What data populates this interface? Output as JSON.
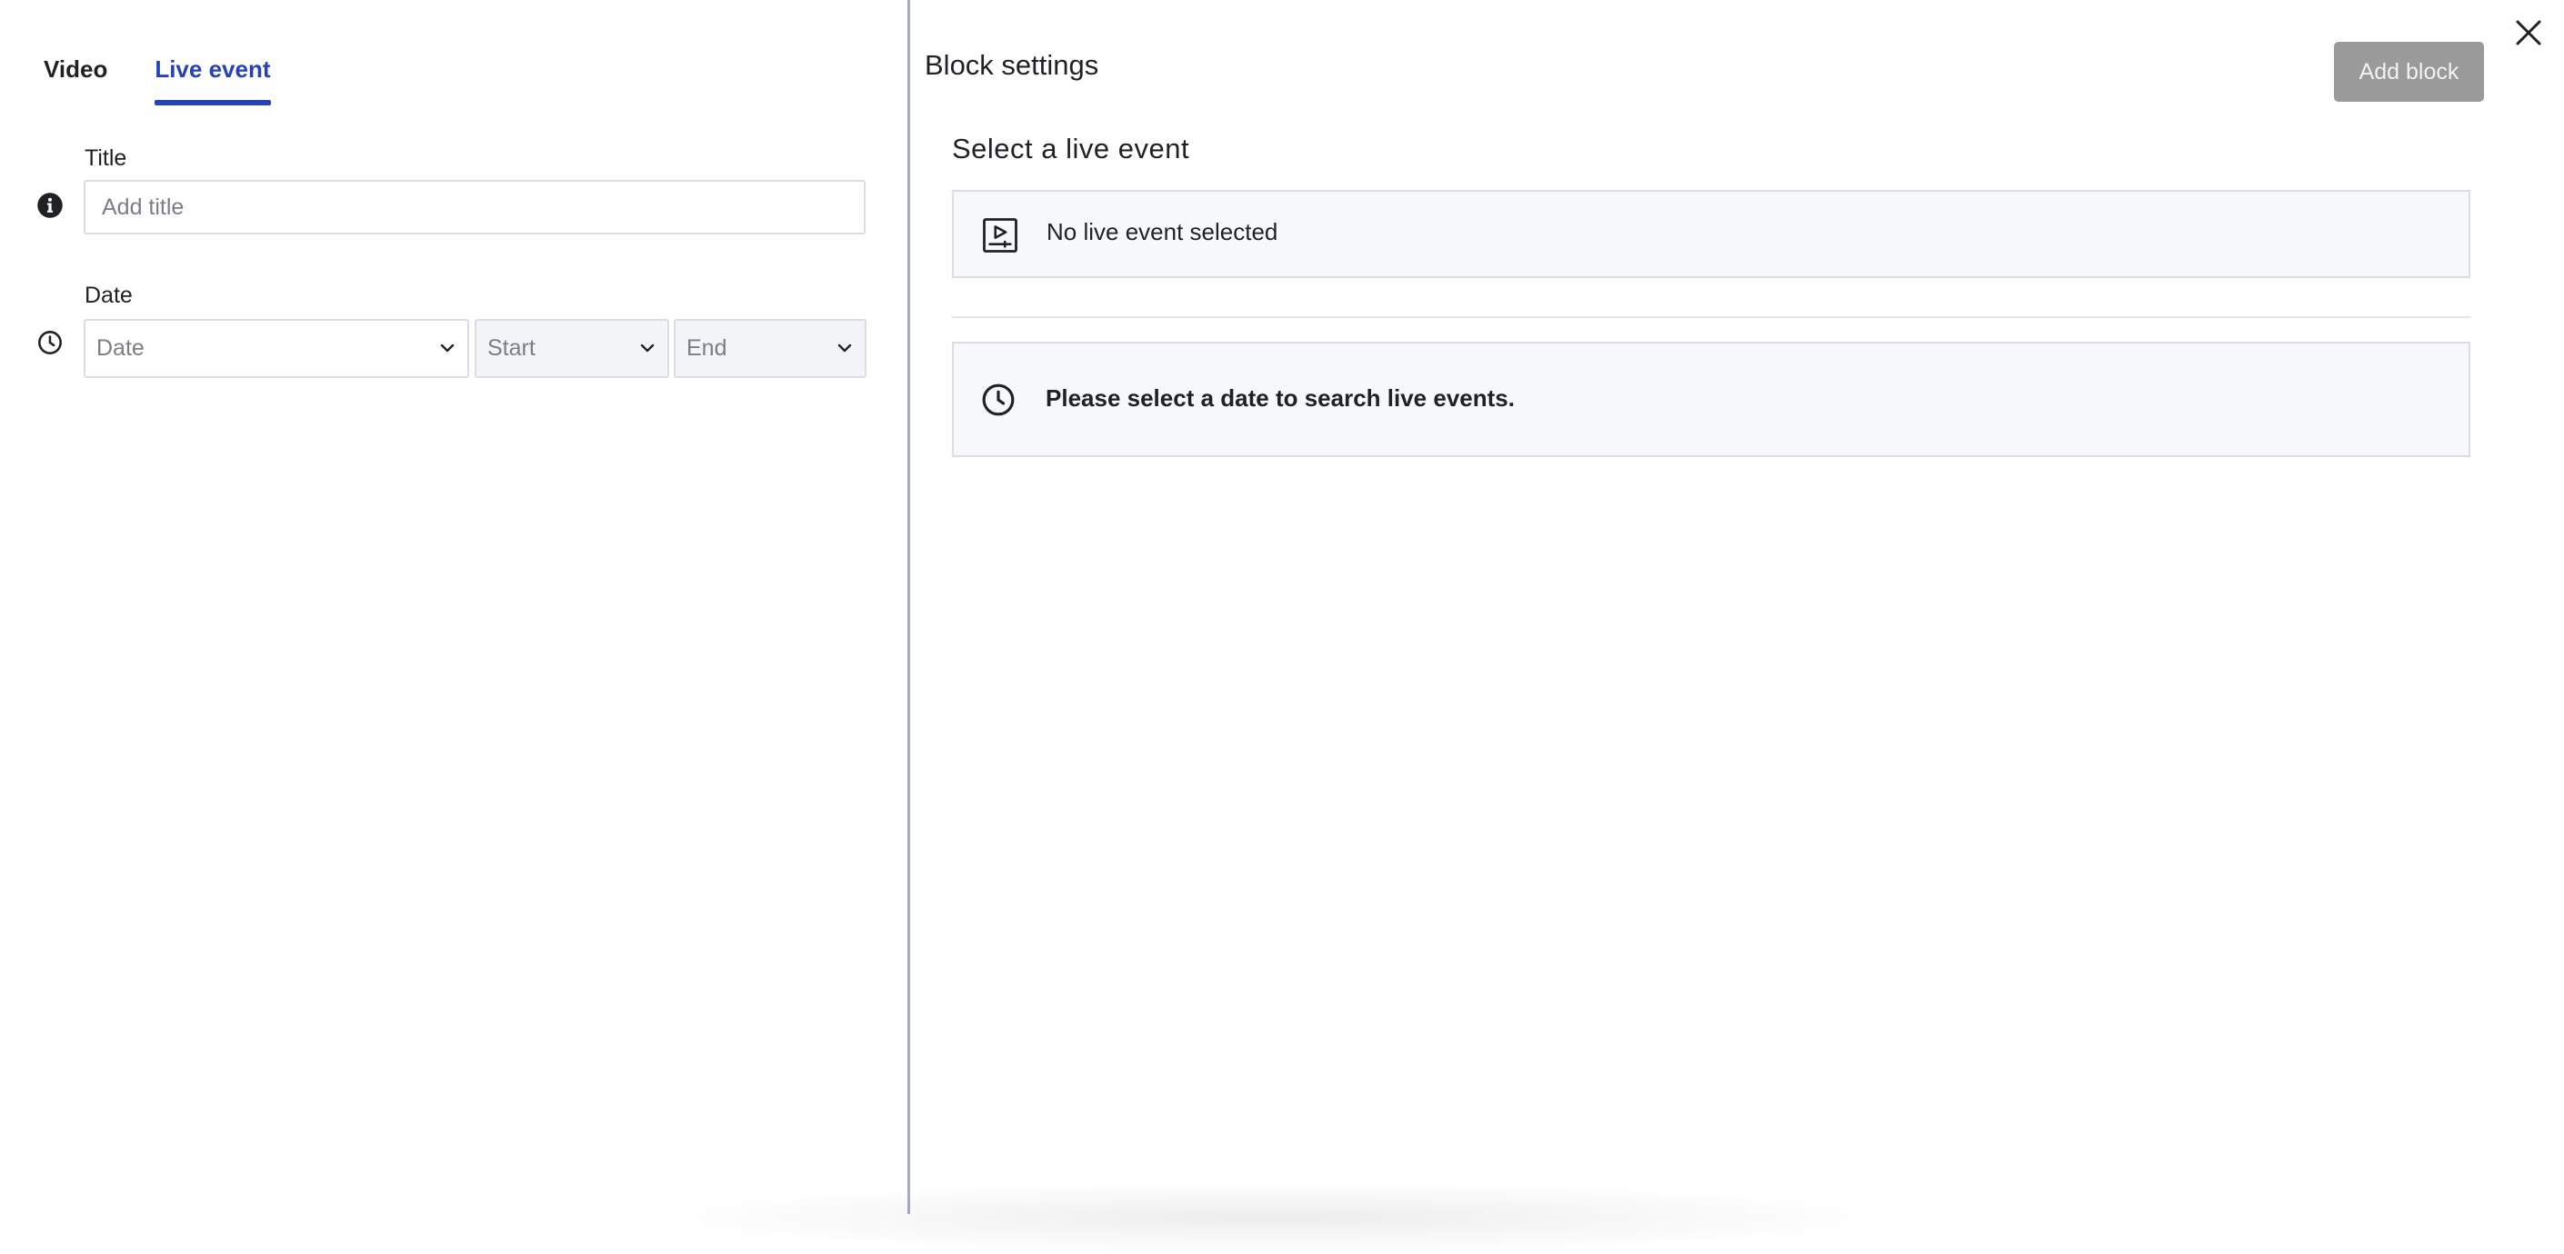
{
  "tabs": [
    {
      "label": "Video",
      "active": false
    },
    {
      "label": "Live event",
      "active": true
    }
  ],
  "form": {
    "title_label": "Title",
    "title_placeholder": "Add title",
    "title_value": "",
    "date_label": "Date",
    "date_select": {
      "value": "Date"
    },
    "start_select": {
      "value": "Start"
    },
    "end_select": {
      "value": "End"
    }
  },
  "panel": {
    "title": "Block settings",
    "add_block_label": "Add block",
    "section_heading": "Select a live event",
    "no_event_text": "No live event selected",
    "date_notice": "Please select a date to search live events."
  },
  "icons": {
    "title_row": "info-icon",
    "date_row": "clock-icon",
    "close": "close-icon",
    "selected_event": "video-play-icon",
    "date_notice": "clock-icon",
    "select_chevron": "chevron-down-icon"
  },
  "colors": {
    "accent": "#2742b8",
    "button_disabled": "#9a9a9a",
    "card_background": "#f7f8fb",
    "border": "#dcdde2",
    "divider": "#a7abc4"
  }
}
